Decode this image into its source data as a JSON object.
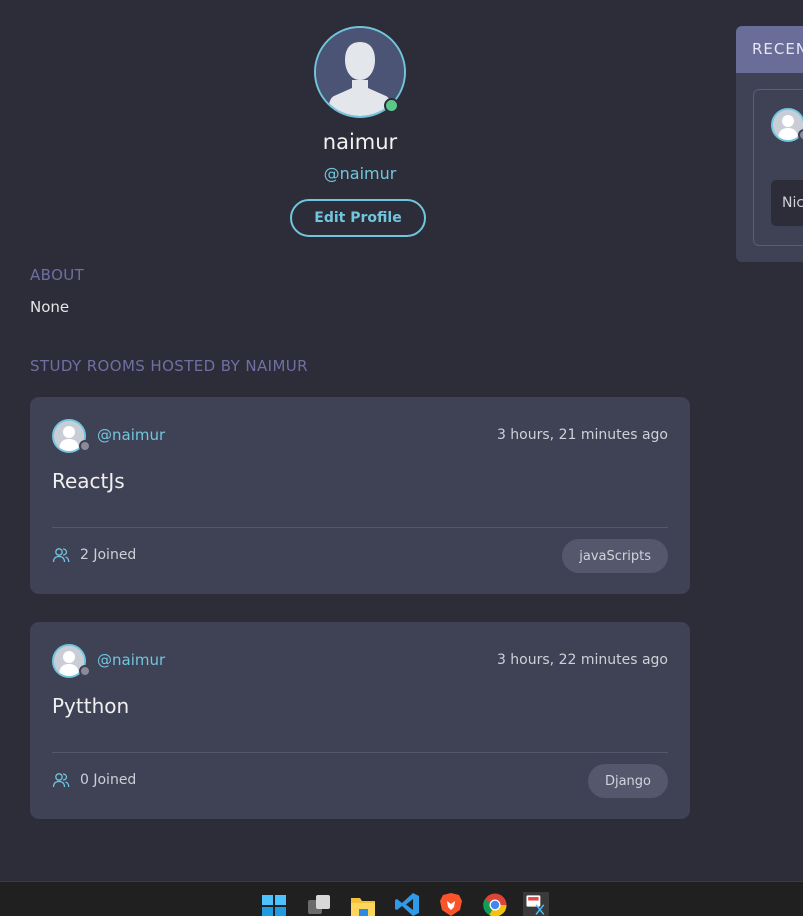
{
  "profile": {
    "name": "naimur",
    "handle": "@naimur",
    "edit_label": "Edit Profile"
  },
  "about": {
    "title": "ABOUT",
    "text": "None"
  },
  "rooms_section": {
    "title": "STUDY ROOMS HOSTED BY NAIMUR"
  },
  "rooms": [
    {
      "host": "@naimur",
      "time": "3 hours, 21 minutes ago",
      "title": "ReactJs",
      "joined": "2 Joined",
      "topic": "javaScripts"
    },
    {
      "host": "@naimur",
      "time": "3 hours, 22 minutes ago",
      "title": "Pytthon",
      "joined": "0 Joined",
      "topic": "Django"
    }
  ],
  "recent_panel": {
    "header": "RECEN",
    "snippet": "Nic"
  },
  "colors": {
    "background": "#2d2d39",
    "card": "#3f4155",
    "accent": "#71c6dd",
    "section_title": "#6f6fa5",
    "online": "#59c98a"
  },
  "taskbar": {
    "icons": [
      "windows-start-icon",
      "task-view-icon",
      "file-explorer-icon",
      "vscode-icon",
      "brave-icon",
      "chrome-icon",
      "snipping-tool-icon"
    ]
  }
}
